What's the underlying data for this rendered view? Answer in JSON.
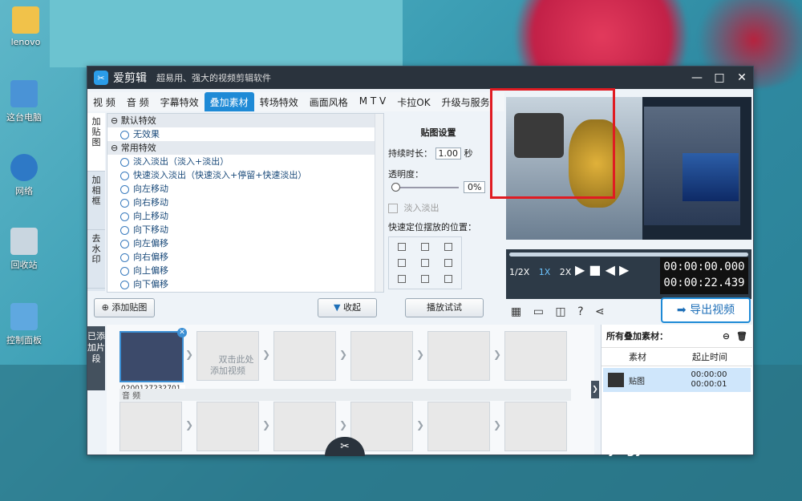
{
  "desktop": {
    "icons": [
      {
        "label": "lenovo"
      },
      {
        "label": "这台电脑"
      },
      {
        "label": "网络"
      },
      {
        "label": "回收站"
      },
      {
        "label": "控制面板"
      }
    ]
  },
  "app": {
    "name": "爱剪辑",
    "slogan": "超易用、强大的视频剪辑软件",
    "window_controls": {
      "min": "—",
      "max": "□",
      "close": "✕"
    }
  },
  "tabs": [
    "视 频",
    "音 频",
    "字幕特效",
    "叠加素材",
    "转场特效",
    "画面风格",
    "M T V",
    "卡拉OK",
    "升级与服务"
  ],
  "active_tab": "叠加素材",
  "vtabs": [
    "加贴图",
    "加相框",
    "去水印"
  ],
  "effects": {
    "groups": [
      {
        "name": "默认特效",
        "items": [
          "无效果"
        ]
      },
      {
        "name": "常用特效",
        "items": [
          "淡入淡出（淡入+淡出）",
          "快速淡入淡出（快速淡入+停留+快速淡出）",
          "向左移动",
          "向右移动",
          "向上移动",
          "向下移动",
          "向左偏移",
          "向右偏移",
          "向上偏移",
          "向下偏移"
        ]
      }
    ]
  },
  "buttons": {
    "add_sticker": "添加贴图",
    "collapse": "收起",
    "preview_try": "播放试试",
    "export": "导出视频"
  },
  "settings": {
    "section_title": "贴图设置",
    "duration_label": "持续时长：",
    "duration_value": "1.00",
    "duration_unit": "秒",
    "opacity_label": "透明度：",
    "opacity_value": "0%",
    "fade_label": "淡入淡出",
    "position_label": "快速定位摆放的位置："
  },
  "player": {
    "speeds": [
      "1/2X",
      "1X",
      "2X"
    ],
    "active_speed": "1X",
    "time_current": "00:00:00.000",
    "time_total": "00:00:22.439"
  },
  "timeline": {
    "label": "已添加片段",
    "clip_name": "0200127232701",
    "placeholder": "双击此处\n添加视频",
    "audio_label": "音 频"
  },
  "overlay_panel": {
    "title": "所有叠加素材：",
    "col_material": "素材",
    "col_time": "起止时间",
    "row_name": "贴图",
    "row_start": "00:00:00",
    "row_end": "00:00:01"
  },
  "watermark": {
    "brand": "Baidu 经验",
    "url": "jingyan.baidu.com"
  }
}
